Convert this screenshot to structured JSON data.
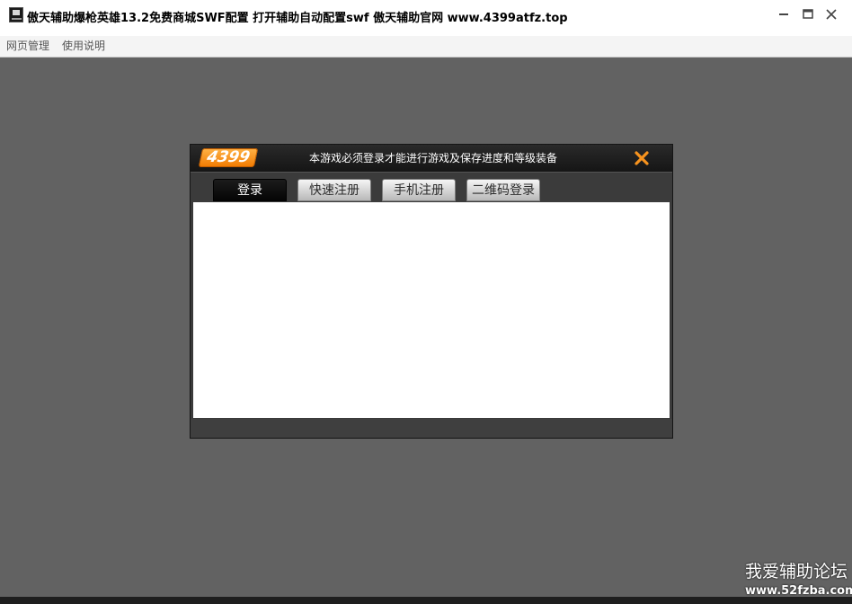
{
  "window": {
    "title": "傲天辅助爆枪英雄13.2免费商城SWF配置 打开辅助自动配置swf 傲天辅助官网 www.4399atfz.top",
    "controls": [
      "minimize-icon",
      "maximize-icon",
      "close-icon"
    ]
  },
  "menu": {
    "items": [
      {
        "label": "网页管理"
      },
      {
        "label": "使用说明"
      }
    ]
  },
  "dialog": {
    "logo": "4399",
    "notice": "本游戏必须登录才能进行游戏及保存进度和等级装备",
    "close_icon": "orange-x-close-icon",
    "accent_color": "#f7931e",
    "tabs": [
      {
        "label": "登录",
        "active": true
      },
      {
        "label": "快速注册",
        "active": false
      },
      {
        "label": "手机注册",
        "active": false
      },
      {
        "label": "二维码登录",
        "active": false
      }
    ]
  },
  "watermark": {
    "line1": "我爱辅助论坛",
    "line2": "www.52fzba.com"
  }
}
